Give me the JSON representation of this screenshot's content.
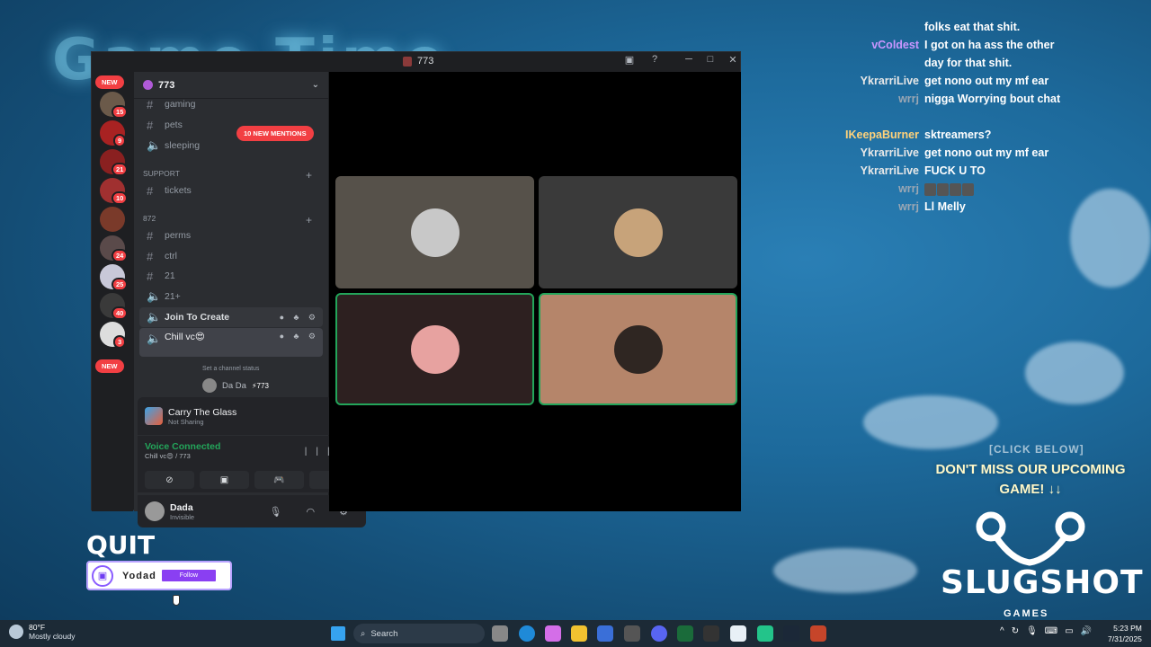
{
  "chat": [
    {
      "user": "",
      "msg": "folks eat that shit.",
      "color": "#c2b2ff"
    },
    {
      "user": "vColdest",
      "msg": "I got on ha ass the other day for that shit.",
      "color": "#c996ff"
    },
    {
      "user": "YkrarriLive",
      "msg": "get nono out my mf ear",
      "color": "#e8e8e8"
    },
    {
      "user": "wrrj",
      "msg": "nigga Worrying bout chat",
      "color": "#9aa7b4"
    },
    {
      "user": "IKeepaBurner",
      "msg": "sktreamers?",
      "color": "#ffd27a"
    },
    {
      "user": "YkrarriLive",
      "msg": "get nono out my mf ear",
      "color": "#e8e8e8"
    },
    {
      "user": "YkrarriLive",
      "msg": "FUCK U TO",
      "color": "#e8e8e8"
    },
    {
      "user": "wrrj",
      "msg": "",
      "color": "#9aa7b4",
      "emotes": 4
    },
    {
      "user": "wrrj",
      "msg": "Ll Melly",
      "color": "#9aa7b4"
    }
  ],
  "promo": {
    "small": "[CLICK BELOW]",
    "big": "DON'T MISS OUR UPCOMING GAME! ↓↓",
    "brand": "SLUGSHOT",
    "brand_sub": "GAMES"
  },
  "overlay": {
    "quit": "QUIT",
    "twitch_name": "Yodad",
    "follow": "Follow"
  },
  "window": {
    "title": "773",
    "guild": "773",
    "new_label": "NEW",
    "mentions": "10 NEW MENTIONS",
    "server_badges": [
      "15",
      "9",
      "21",
      "10",
      "24",
      "25",
      "40",
      "3"
    ],
    "channels": {
      "gaming": "gaming",
      "pets": "pets",
      "sleeping": "sleeping",
      "cat_support": "SUPPORT",
      "tickets": "tickets",
      "cat_872": "872",
      "perms": "perms",
      "ctrl": "ctrl",
      "c21": "21",
      "c21plus": "21+",
      "join": "Join To Create",
      "chill": "Chill vc😍",
      "chill_status": "Set a channel status",
      "voice_user": "Da Da",
      "voice_user_tag": "⚡773"
    },
    "activity": {
      "title": "Carry The Glass",
      "sub": "Not Sharing"
    },
    "voice": {
      "title": "Voice Connected",
      "sub": "Chill vc😍 / 773"
    },
    "user": {
      "name": "Dada",
      "status": "Invisible"
    },
    "tiles": [
      {
        "bg": "#56514a",
        "avatar": "#c8c8c8",
        "speaking": false
      },
      {
        "bg": "#3a3a3a",
        "avatar": "#c7a37a",
        "speaking": false
      },
      {
        "bg": "#2d2020",
        "avatar": "#e7a2a0",
        "speaking": true
      },
      {
        "bg": "#b5856a",
        "avatar": "#2f2622",
        "speaking": true
      }
    ]
  },
  "taskbar": {
    "temp": "80°F",
    "condition": "Mostly cloudy",
    "search": "Search",
    "time": "5:23 PM",
    "date": "7/31/2025"
  }
}
